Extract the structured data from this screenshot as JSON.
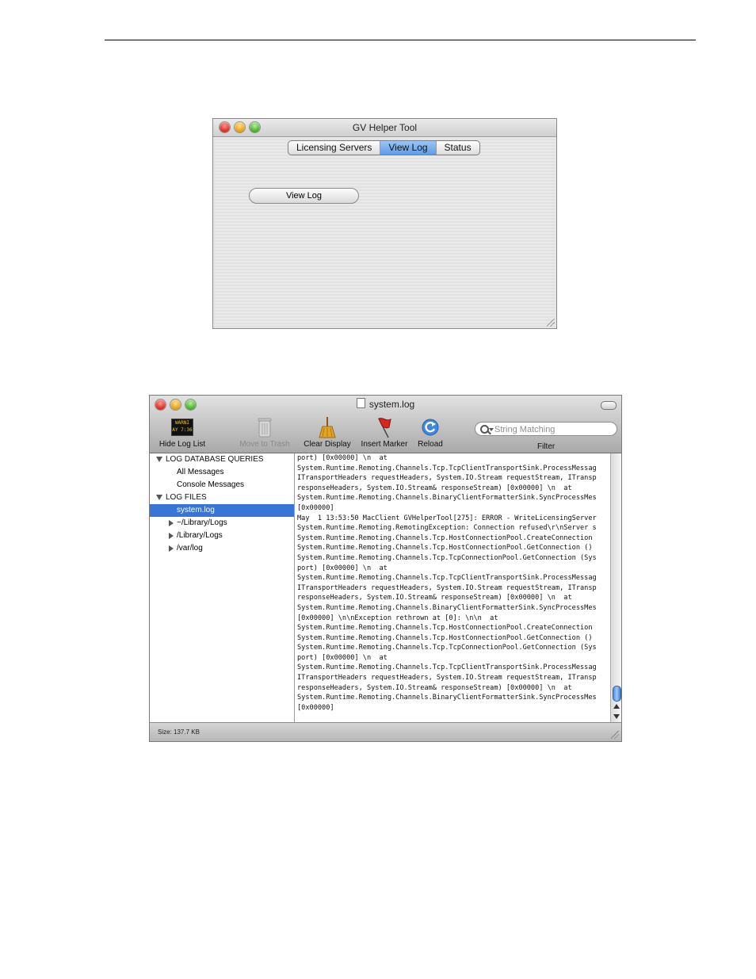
{
  "gv_window": {
    "title": "GV Helper Tool",
    "tabs": [
      "Licensing Servers",
      "View Log",
      "Status"
    ],
    "selected_tab": "View Log",
    "view_log_button": "View Log"
  },
  "log_window": {
    "title": "system.log",
    "toolbar": {
      "hide_log_list": "Hide Log List",
      "warn_icon_text": "WARNI\nAY 7:36",
      "move_to_trash": "Move to Trash",
      "clear_display": "Clear Display",
      "insert_marker": "Insert Marker",
      "reload": "Reload"
    },
    "search": {
      "placeholder": "String Matching",
      "filter_label": "Filter"
    },
    "sidebar": {
      "log_database_queries": "LOG DATABASE QUERIES",
      "all_messages": "All Messages",
      "console_messages": "Console Messages",
      "log_files": "LOG FILES",
      "system_log": "system.log",
      "user_library_logs": "~/Library/Logs",
      "library_logs": "/Library/Logs",
      "var_log": "/var/log"
    },
    "log_lines": [
      "port) [0x00000] \\n  at",
      "System.Runtime.Remoting.Channels.Tcp.TcpClientTransportSink.ProcessMessag",
      "ITransportHeaders requestHeaders, System.IO.Stream requestStream, ITransp",
      "responseHeaders, System.IO.Stream& responseStream) [0x00000] \\n  at",
      "System.Runtime.Remoting.Channels.BinaryClientFormatterSink.SyncProcessMes",
      "[0x00000]",
      "May  1 13:53:50 MacClient GVHelperTool[275]: ERROR - WriteLicensingServer",
      "System.Runtime.Remoting.RemotingException: Connection refused\\r\\nServer s",
      "System.Runtime.Remoting.Channels.Tcp.HostConnectionPool.CreateConnection",
      "System.Runtime.Remoting.Channels.Tcp.HostConnectionPool.GetConnection ()",
      "System.Runtime.Remoting.Channels.Tcp.TcpConnectionPool.GetConnection (Sys",
      "port) [0x00000] \\n  at",
      "System.Runtime.Remoting.Channels.Tcp.TcpClientTransportSink.ProcessMessag",
      "ITransportHeaders requestHeaders, System.IO.Stream requestStream, ITransp",
      "responseHeaders, System.IO.Stream& responseStream) [0x00000] \\n  at",
      "System.Runtime.Remoting.Channels.BinaryClientFormatterSink.SyncProcessMes",
      "[0x00000] \\n\\nException rethrown at [0]: \\n\\n  at",
      "System.Runtime.Remoting.Channels.Tcp.HostConnectionPool.CreateConnection",
      "System.Runtime.Remoting.Channels.Tcp.HostConnectionPool.GetConnection ()",
      "System.Runtime.Remoting.Channels.Tcp.TcpConnectionPool.GetConnection (Sys",
      "port) [0x00000] \\n  at",
      "System.Runtime.Remoting.Channels.Tcp.TcpClientTransportSink.ProcessMessag",
      "ITransportHeaders requestHeaders, System.IO.Stream requestStream, ITransp",
      "responseHeaders, System.IO.Stream& responseStream) [0x00000] \\n  at",
      "System.Runtime.Remoting.Channels.BinaryClientFormatterSink.SyncProcessMes",
      "[0x00000]"
    ],
    "status": "Size: 137.7 KB"
  }
}
